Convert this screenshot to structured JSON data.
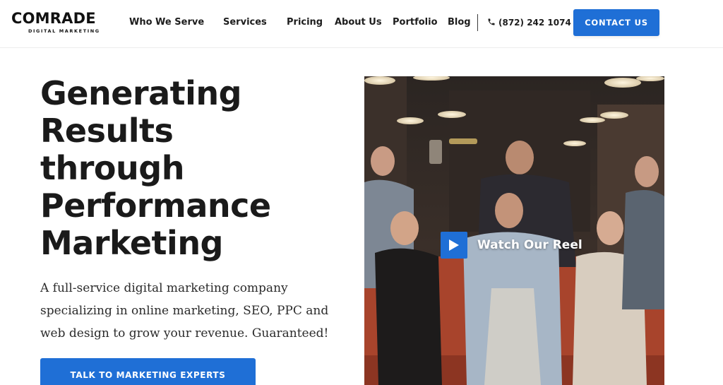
{
  "brand": {
    "name": "COMRADE",
    "tagline": "DIGITAL MARKETING"
  },
  "nav": {
    "items": [
      {
        "label": "Who We Serve"
      },
      {
        "label": "Services"
      },
      {
        "label": "Pricing"
      },
      {
        "label": "About Us"
      },
      {
        "label": "Portfolio"
      },
      {
        "label": "Blog"
      }
    ],
    "phone": "(872) 242 1074",
    "phone_icon": "phone-icon",
    "contact_label": "CONTACT US"
  },
  "hero": {
    "title_lines": [
      "Generating",
      "Results",
      "through",
      "Performance",
      "Marketing"
    ],
    "subtitle_lines": [
      "A full-service digital marketing company",
      "specializing in online marketing, SEO, PPC and",
      "web design to grow your revenue. Guaranteed!"
    ],
    "cta_label": "TALK TO MARKETING EXPERTS"
  },
  "video": {
    "reel_label": "Watch Our Reel",
    "play_icon": "play-icon"
  },
  "colors": {
    "accent": "#1f6fd6",
    "text": "#1a1a1a"
  }
}
